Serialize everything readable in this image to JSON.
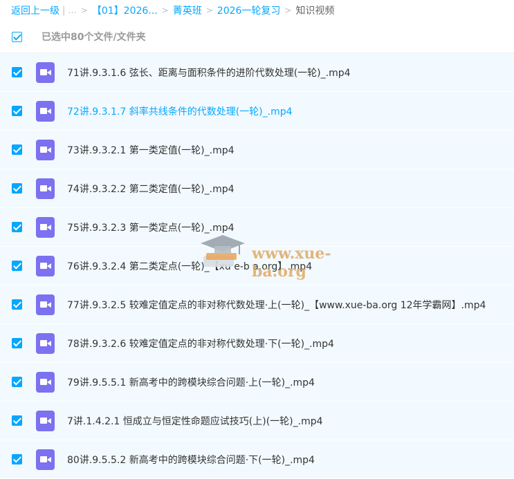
{
  "breadcrumb": {
    "back": "返回上一级",
    "sep_bar": "|",
    "ellipsis": "...",
    "sep": ">",
    "items": [
      "【01】2026...",
      "菁英班",
      "2026一轮复习"
    ],
    "current": "知识视频"
  },
  "selection": {
    "text": "已选中80个文件/文件夹",
    "all_checked": true
  },
  "files": [
    {
      "name": "71讲.9.3.1.6 弦长、距离与面积条件的进阶代数处理(一轮)_.mp4",
      "checked": true,
      "icon": "video-file-icon"
    },
    {
      "name": "72讲.9.3.1.7 斜率共线条件的代数处理(一轮)_.mp4",
      "checked": true,
      "icon": "video-file-icon"
    },
    {
      "name": "73讲.9.3.2.1 第一类定值(一轮)_.mp4",
      "checked": true,
      "icon": "video-file-icon"
    },
    {
      "name": "74讲.9.3.2.2 第二类定值(一轮)_.mp4",
      "checked": true,
      "icon": "video-file-icon"
    },
    {
      "name": "75讲.9.3.2.3 第一类定点(一轮)_.mp4",
      "checked": true,
      "icon": "video-file-icon"
    },
    {
      "name": "76讲.9.3.2.4 第二类定点(一轮)_【xu e-b a.org】.mp4",
      "checked": true,
      "icon": "video-file-icon"
    },
    {
      "name": "77讲.9.3.2.5 较难定值定点的非对称代数处理·上(一轮)_【www.xue-ba.org 12年学霸网】.mp4",
      "checked": true,
      "icon": "video-file-icon"
    },
    {
      "name": "78讲.9.3.2.6 较难定值定点的非对称代数处理·下(一轮)_.mp4",
      "checked": true,
      "icon": "video-file-icon"
    },
    {
      "name": "79讲.9.5.5.1 新高考中的跨模块综合问题·上(一轮)_.mp4",
      "checked": true,
      "icon": "video-file-icon"
    },
    {
      "name": "7讲.1.4.2.1 恒成立与恒定性命题应试技巧(上)(一轮)_.mp4",
      "checked": true,
      "icon": "video-file-icon"
    },
    {
      "name": "80讲.9.5.5.2 新高考中的跨模块综合问题·下(一轮)_.mp4",
      "checked": true,
      "icon": "video-file-icon"
    }
  ],
  "hovered_index": 1,
  "watermark": {
    "text": "www.xue-ba.org",
    "icon": "graduation-cap-icon"
  },
  "colors": {
    "accent": "#06a7ff",
    "row_bg": "#f2faff",
    "video_icon": "#7c71f0"
  }
}
